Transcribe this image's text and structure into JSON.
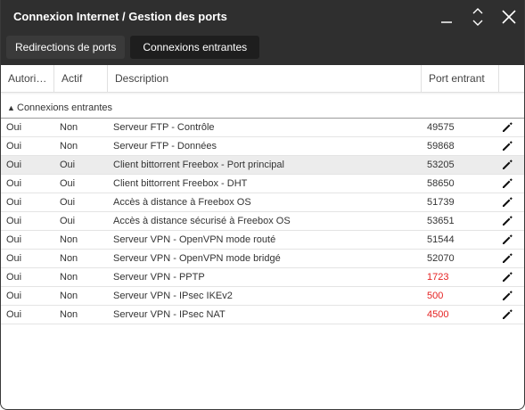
{
  "window": {
    "title": "Connexion Internet / Gestion des ports"
  },
  "tabs": [
    {
      "label": "Redirections de ports",
      "active": false
    },
    {
      "label": "Connexions entrantes",
      "active": true
    }
  ],
  "columns": {
    "authorized": "Autori…",
    "active": "Actif",
    "description": "Description",
    "port": "Port entrant"
  },
  "group": {
    "label": "Connexions entrantes"
  },
  "colors": {
    "titlebar": "#2f2f2f",
    "highlight_port": "#e52222"
  },
  "rows": [
    {
      "authorized": "Oui",
      "active": "Non",
      "description": "Serveur FTP - Contrôle",
      "port": "49575",
      "port_highlight": false
    },
    {
      "authorized": "Oui",
      "active": "Non",
      "description": "Serveur FTP - Données",
      "port": "59868",
      "port_highlight": false
    },
    {
      "authorized": "Oui",
      "active": "Oui",
      "description": "Client bittorrent Freebox - Port principal",
      "port": "53205",
      "port_highlight": false,
      "selected": true
    },
    {
      "authorized": "Oui",
      "active": "Oui",
      "description": "Client bittorrent Freebox - DHT",
      "port": "58650",
      "port_highlight": false
    },
    {
      "authorized": "Oui",
      "active": "Oui",
      "description": "Accès à distance à Freebox OS",
      "port": "51739",
      "port_highlight": false
    },
    {
      "authorized": "Oui",
      "active": "Oui",
      "description": "Accès à distance sécurisé à Freebox OS",
      "port": "53651",
      "port_highlight": false
    },
    {
      "authorized": "Oui",
      "active": "Non",
      "description": "Serveur VPN - OpenVPN mode routé",
      "port": "51544",
      "port_highlight": false
    },
    {
      "authorized": "Oui",
      "active": "Non",
      "description": "Serveur VPN - OpenVPN mode bridgé",
      "port": "52070",
      "port_highlight": false
    },
    {
      "authorized": "Oui",
      "active": "Non",
      "description": "Serveur VPN - PPTP",
      "port": "1723",
      "port_highlight": true
    },
    {
      "authorized": "Oui",
      "active": "Non",
      "description": "Serveur VPN - IPsec IKEv2",
      "port": "500",
      "port_highlight": true
    },
    {
      "authorized": "Oui",
      "active": "Non",
      "description": "Serveur VPN - IPsec NAT",
      "port": "4500",
      "port_highlight": true
    }
  ],
  "icons": {
    "minimize": "minimize-icon",
    "resize": "resize-vertical-icon",
    "close": "close-icon",
    "edit": "pencil-icon",
    "collapse": "chevron-up-icon"
  }
}
